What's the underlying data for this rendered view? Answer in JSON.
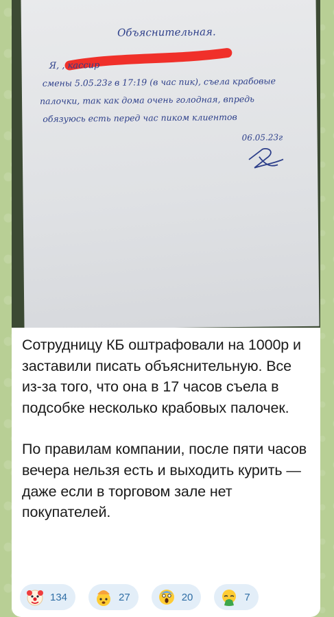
{
  "photo": {
    "heading": "Объяснительная.",
    "lines": [
      "Я,                           , кассир ",
      "смены 5.05.23г в 17:19 (в час пик), съела крабовые",
      "палочки, так как дома очень голодная, впредь",
      "обязуюсь есть перед час пиком клиентов"
    ],
    "date": "06.05.23г"
  },
  "message": {
    "paragraph1": "Сотрудницу КБ оштрафовали на 1000р и заставили писать объяснительную. Все из-за того, что она в 17 часов съела в подсобке несколько крабовых палочек.",
    "paragraph2": "По правилам компании, после пяти часов вечера нельзя есть и выходить курить — даже если в торговом зале нет покупателей."
  },
  "reactions": [
    {
      "icon": "clown-face-icon",
      "count": "134"
    },
    {
      "icon": "exploding-head-icon",
      "count": "27"
    },
    {
      "icon": "scream-face-icon",
      "count": "20"
    },
    {
      "icon": "nauseated-face-icon",
      "count": "7"
    }
  ],
  "colors": {
    "background": "#b8cf95",
    "bubble": "#ffffff",
    "reaction_bg": "#e3eef8",
    "reaction_count": "#2f6ea5",
    "redaction": "#f0302a",
    "ink": "#2d3f8a"
  }
}
